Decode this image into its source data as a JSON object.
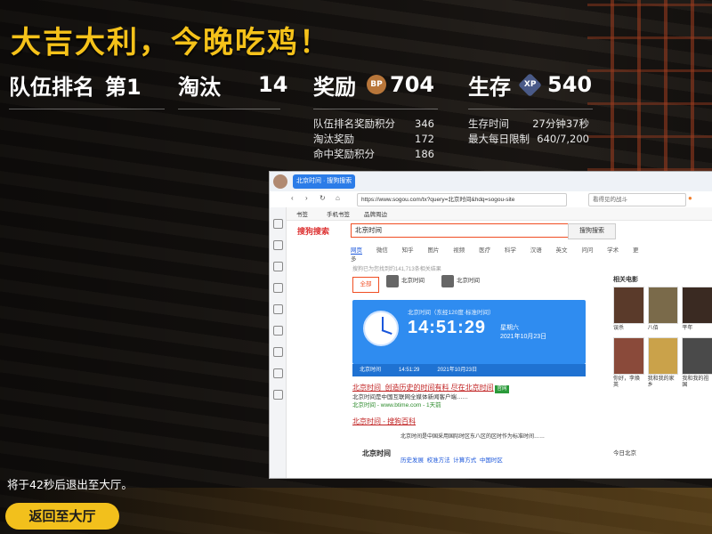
{
  "result": {
    "title": "大吉大利，今晚吃鸡！",
    "team_rank_label": "队伍排名",
    "team_rank_value": "第1",
    "kills_label": "淘汰",
    "kills_value": "14",
    "reward_label": "奖励",
    "reward_badge": "BP",
    "reward_value": "704",
    "survival_label": "生存",
    "survival_badge": "XP",
    "survival_value": "540",
    "details_left": [
      {
        "label": "队伍排名奖励积分",
        "value": "346"
      },
      {
        "label": "淘汰奖励",
        "value": "172"
      },
      {
        "label": "命中奖励积分",
        "value": "186"
      }
    ],
    "details_right": [
      {
        "label": "生存时间",
        "value": "27分钟37秒"
      },
      {
        "label": "最大每日限制",
        "value": "640/7,200"
      }
    ],
    "exit_message": "将于42秒后退出至大厅。",
    "return_button": "返回至大厅"
  },
  "browser": {
    "tab_label": "北京时间 · 搜狗搜索",
    "url": "https://www.sogou.com/tx?query=北京时间&hdq=sogou-site",
    "toolbar_search": "看得见的战斗",
    "bookmarks": [
      "书签",
      "手机书签",
      "品牌周边"
    ],
    "logo": "搜狗搜索",
    "query": "北京时间",
    "search_button": "搜狗搜索",
    "tabs": [
      "网页",
      "微信",
      "知乎",
      "图片",
      "视频",
      "医疗",
      "科学",
      "汉语",
      "英文",
      "问问",
      "学术",
      "更多"
    ],
    "meta": "搜狗已为您找到约141,713条相关结果",
    "all_button": "全部",
    "accounts": [
      "北京时间",
      "北京时间"
    ],
    "clock": {
      "subtitle": "北京时间（东经120度·标准时间）",
      "time": "14:51:29",
      "weekday": "星期六",
      "date": "2021年10月23日",
      "footer_city": "北京时间",
      "footer_time": "14:51:29",
      "footer_date": "2021年10月23日"
    },
    "results": [
      {
        "title": "北京时间_创造历史的时间有料 尽在北京时间",
        "tag": "官网",
        "desc": "北京时间是中国互联网全媒体新闻客户端……",
        "url": "北京时间 - www.btime.com - 1天前"
      },
      {
        "title": "北京时间 - 搜狗百科",
        "desc": "北京时间是中国采用国际时区东八区的区时作为标准时间……",
        "links": [
          "历史发展",
          "校准方法",
          "计算方式",
          "中国时区"
        ]
      }
    ],
    "baike_logo": "北京时间",
    "right_panel": {
      "title": "相关电影",
      "captions": [
        "误杀",
        "八佰",
        "平年",
        "你好，李焕英",
        "我和我的家乡",
        "我和我的祖国"
      ]
    },
    "share": "今日北京"
  },
  "colors": {
    "accent": "#f5c21a",
    "button": "#f2c01c",
    "browser_blue": "#2f8cf0"
  }
}
